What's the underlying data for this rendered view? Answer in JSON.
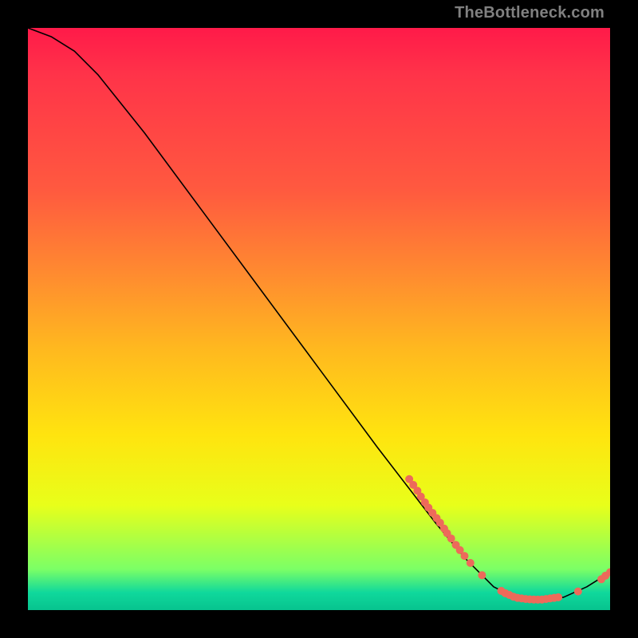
{
  "watermark": "TheBottleneck.com",
  "chart_data": {
    "type": "line",
    "title": "",
    "xlabel": "",
    "ylabel": "",
    "xlim": [
      0,
      100
    ],
    "ylim": [
      0,
      100
    ],
    "curve": [
      {
        "x": 0.0,
        "y": 100.0
      },
      {
        "x": 4.0,
        "y": 98.5
      },
      {
        "x": 8.0,
        "y": 96.0
      },
      {
        "x": 12.0,
        "y": 92.0
      },
      {
        "x": 20.0,
        "y": 82.0
      },
      {
        "x": 30.0,
        "y": 68.5
      },
      {
        "x": 40.0,
        "y": 55.0
      },
      {
        "x": 50.0,
        "y": 41.5
      },
      {
        "x": 60.0,
        "y": 28.0
      },
      {
        "x": 65.0,
        "y": 21.5
      },
      {
        "x": 70.0,
        "y": 15.0
      },
      {
        "x": 75.0,
        "y": 9.0
      },
      {
        "x": 80.0,
        "y": 4.0
      },
      {
        "x": 84.0,
        "y": 2.0
      },
      {
        "x": 88.0,
        "y": 1.8
      },
      {
        "x": 92.0,
        "y": 2.2
      },
      {
        "x": 96.0,
        "y": 4.0
      },
      {
        "x": 100.0,
        "y": 6.5
      }
    ],
    "scatter_points": [
      {
        "x": 65.5,
        "y": 22.5
      },
      {
        "x": 66.2,
        "y": 21.5
      },
      {
        "x": 66.9,
        "y": 20.5
      },
      {
        "x": 67.5,
        "y": 19.5
      },
      {
        "x": 68.2,
        "y": 18.5
      },
      {
        "x": 68.8,
        "y": 17.6
      },
      {
        "x": 69.5,
        "y": 16.7
      },
      {
        "x": 70.2,
        "y": 15.8
      },
      {
        "x": 70.8,
        "y": 15.0
      },
      {
        "x": 71.5,
        "y": 14.0
      },
      {
        "x": 72.0,
        "y": 13.2
      },
      {
        "x": 72.7,
        "y": 12.3
      },
      {
        "x": 73.5,
        "y": 11.2
      },
      {
        "x": 74.2,
        "y": 10.3
      },
      {
        "x": 75.0,
        "y": 9.3
      },
      {
        "x": 76.0,
        "y": 8.1
      },
      {
        "x": 78.0,
        "y": 6.0
      },
      {
        "x": 81.3,
        "y": 3.3
      },
      {
        "x": 82.0,
        "y": 2.9
      },
      {
        "x": 82.7,
        "y": 2.6
      },
      {
        "x": 83.4,
        "y": 2.3
      },
      {
        "x": 84.1,
        "y": 2.1
      },
      {
        "x": 84.8,
        "y": 2.0
      },
      {
        "x": 85.5,
        "y": 1.9
      },
      {
        "x": 86.2,
        "y": 1.85
      },
      {
        "x": 86.9,
        "y": 1.82
      },
      {
        "x": 87.6,
        "y": 1.8
      },
      {
        "x": 88.3,
        "y": 1.82
      },
      {
        "x": 89.0,
        "y": 1.9
      },
      {
        "x": 89.7,
        "y": 2.0
      },
      {
        "x": 90.4,
        "y": 2.1
      },
      {
        "x": 91.1,
        "y": 2.2
      },
      {
        "x": 94.5,
        "y": 3.2
      },
      {
        "x": 98.5,
        "y": 5.3
      },
      {
        "x": 99.2,
        "y": 5.9
      },
      {
        "x": 100.0,
        "y": 6.5
      }
    ],
    "series": [
      {
        "name": "bottleneck-curve",
        "color": "#000000"
      },
      {
        "name": "sample-points",
        "color": "#ed6a5a"
      }
    ],
    "point_radius": 5.0,
    "line_width": 1.6
  }
}
